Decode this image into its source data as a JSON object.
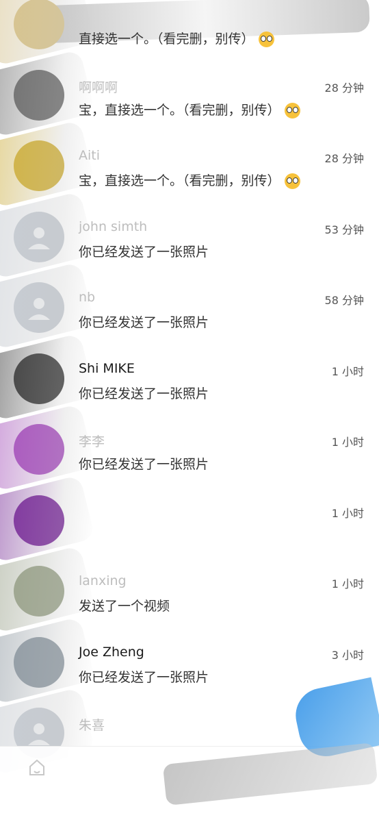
{
  "conversations": [
    {
      "name": "",
      "message": "直接选一个。（看完删，别传）",
      "time": "",
      "avatar_color": "#d9c48a",
      "name_dark": false,
      "emoji": true,
      "avatar_icon": "photo-avatar-icon"
    },
    {
      "name": "啊啊啊",
      "message": "宝，直接选一个。（看完删，别传）",
      "time": "28 分钟",
      "avatar_color": "#6b6b6b",
      "name_dark": false,
      "emoji": true,
      "avatar_icon": "photo-avatar-icon"
    },
    {
      "name": "Aiti",
      "message": "宝，直接选一个。（看完删，别传）",
      "time": "28 分钟",
      "avatar_color": "#d2b23c",
      "name_dark": false,
      "emoji": true,
      "avatar_icon": "photo-avatar-icon"
    },
    {
      "name": "john simth",
      "message": "你已经发送了一张照片",
      "time": "53 分钟",
      "avatar_color": "#c7ccd3",
      "name_dark": false,
      "emoji": false,
      "avatar_icon": "default-person-icon"
    },
    {
      "name": "nb",
      "message": "你已经发送了一张照片",
      "time": "58 分钟",
      "avatar_color": "#c7ccd3",
      "name_dark": false,
      "emoji": false,
      "avatar_icon": "default-person-icon"
    },
    {
      "name": "Shi MIKE",
      "message": "你已经发送了一张照片",
      "time": "1 小时",
      "avatar_color": "#3a3a3a",
      "name_dark": true,
      "emoji": false,
      "avatar_icon": "photo-avatar-icon"
    },
    {
      "name": "李李",
      "message": "你已经发送了一张照片",
      "time": "1 小时",
      "avatar_color": "#a84fbf",
      "name_dark": false,
      "emoji": false,
      "avatar_icon": "letter-avatar-icon"
    },
    {
      "name": "",
      "message": "",
      "time": "1 小时",
      "avatar_color": "#7a2a9b",
      "name_dark": false,
      "emoji": false,
      "avatar_icon": "photo-avatar-icon"
    },
    {
      "name": "lanxing",
      "message": "发送了一个视频",
      "time": "1 小时",
      "avatar_color": "#9aa38a",
      "name_dark": false,
      "emoji": false,
      "avatar_icon": "photo-avatar-icon"
    },
    {
      "name": "Joe Zheng",
      "message": "你已经发送了一张照片",
      "time": "3 小时",
      "avatar_color": "#8f9aa3",
      "name_dark": true,
      "emoji": false,
      "avatar_icon": "photo-avatar-icon"
    },
    {
      "name": "朱喜",
      "message": "",
      "time": "",
      "avatar_color": "#c7ccd3",
      "name_dark": false,
      "emoji": false,
      "avatar_icon": "default-person-icon"
    }
  ],
  "tabbar": {
    "home_icon": "home-icon"
  },
  "scribble_colors": {
    "gray": "#8a8a8a",
    "purple": "#a03bc4",
    "blue": "#2a8ee6"
  }
}
